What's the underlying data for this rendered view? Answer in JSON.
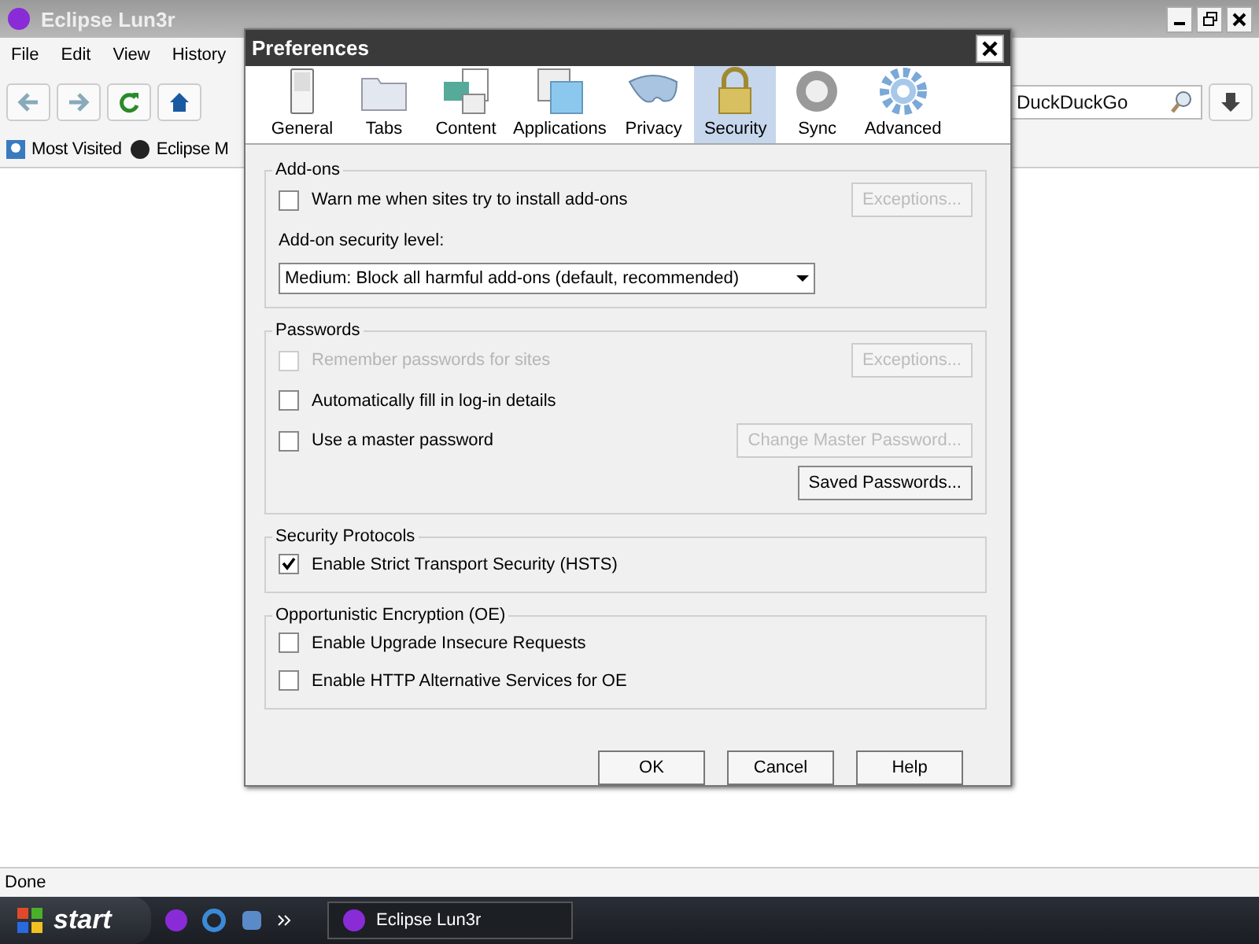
{
  "browser": {
    "title": "Eclipse Lun3r",
    "menu": [
      "File",
      "Edit",
      "View",
      "History"
    ],
    "search": {
      "placeholder": "DuckDuckGo"
    },
    "bookmarks": [
      "Most Visited",
      "Eclipse M"
    ],
    "status": "Done"
  },
  "dialog": {
    "title": "Preferences",
    "panes": [
      {
        "label": "General",
        "selected": false
      },
      {
        "label": "Tabs",
        "selected": false
      },
      {
        "label": "Content",
        "selected": false
      },
      {
        "label": "Applications",
        "selected": false
      },
      {
        "label": "Privacy",
        "selected": false
      },
      {
        "label": "Security",
        "selected": true
      },
      {
        "label": "Sync",
        "selected": false
      },
      {
        "label": "Advanced",
        "selected": false
      }
    ],
    "groups": [
      {
        "title": "Add-ons",
        "rows": [
          {
            "kind": "checkbox",
            "label": "Warn me when sites try to install add-ons",
            "checked": false,
            "disabled": false,
            "button": {
              "label": "Exceptions...",
              "disabled": true
            }
          },
          {
            "kind": "label",
            "label": "Add-on security level:"
          },
          {
            "kind": "select",
            "value": "Medium: Block all harmful add-ons (default, recommended)"
          }
        ]
      },
      {
        "title": "Passwords",
        "rows": [
          {
            "kind": "checkbox",
            "label": "Remember passwords for sites",
            "checked": false,
            "disabled": true,
            "button": {
              "label": "Exceptions...",
              "disabled": true
            }
          },
          {
            "kind": "checkbox",
            "label": "Automatically fill in log-in details",
            "checked": false,
            "disabled": false
          },
          {
            "kind": "checkbox",
            "label": "Use a master password",
            "checked": false,
            "disabled": false,
            "button": {
              "label": "Change Master Password...",
              "disabled": true
            }
          },
          {
            "kind": "button",
            "label": "Saved Passwords...",
            "disabled": false
          }
        ]
      },
      {
        "title": "Security Protocols",
        "rows": [
          {
            "kind": "checkbox",
            "label": "Enable Strict Transport Security (HSTS)",
            "checked": true,
            "disabled": false
          }
        ]
      },
      {
        "title": "Opportunistic Encryption (OE)",
        "rows": [
          {
            "kind": "checkbox",
            "label": "Enable Upgrade Insecure Requests",
            "checked": false,
            "disabled": false
          },
          {
            "kind": "checkbox",
            "label": "Enable HTTP Alternative Services for OE",
            "checked": false,
            "disabled": false
          }
        ]
      }
    ],
    "buttons": [
      "OK",
      "Cancel",
      "Help"
    ]
  },
  "taskbar": {
    "start": "start",
    "task": "Eclipse Lun3r"
  }
}
